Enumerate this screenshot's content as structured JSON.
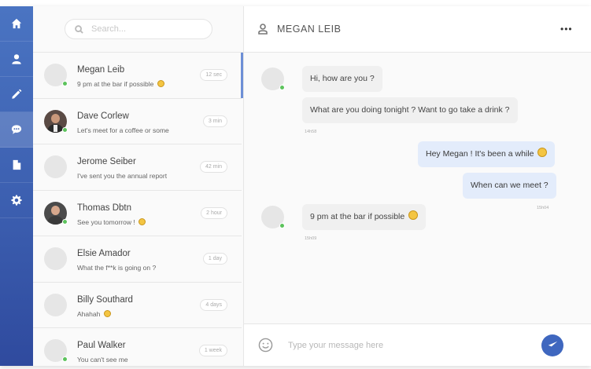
{
  "nav": {
    "items": [
      {
        "icon": "home-icon",
        "active": false
      },
      {
        "icon": "user-icon",
        "active": false
      },
      {
        "icon": "pencil-icon",
        "active": false
      },
      {
        "icon": "chat-icon",
        "active": true
      },
      {
        "icon": "document-icon",
        "active": false
      },
      {
        "icon": "gear-icon",
        "active": false
      }
    ]
  },
  "search": {
    "placeholder": "Search..."
  },
  "contacts": [
    {
      "name": "Megan Leib",
      "message": "9 pm at the bar if possible",
      "time": "12 sec",
      "online": true,
      "photo": false,
      "emoji": true
    },
    {
      "name": "Dave Corlew",
      "message": "Let's meet for a coffee or some",
      "time": "3 min",
      "online": true,
      "photo": true,
      "emoji": false
    },
    {
      "name": "Jerome Seiber",
      "message": "I've sent you the annual report",
      "time": "42 min",
      "online": false,
      "photo": false,
      "emoji": false
    },
    {
      "name": "Thomas Dbtn",
      "message": "See you tomorrow !",
      "time": "2 hour",
      "online": true,
      "photo": true,
      "emoji": true
    },
    {
      "name": "Elsie Amador",
      "message": "What the f**k is going on ?",
      "time": "1 day",
      "online": false,
      "photo": false,
      "emoji": false
    },
    {
      "name": "Billy Southard",
      "message": "Ahahah",
      "time": "4 days",
      "online": false,
      "photo": false,
      "emoji": true
    },
    {
      "name": "Paul Walker",
      "message": "You can't see me",
      "time": "1 week",
      "online": true,
      "photo": false,
      "emoji": false
    }
  ],
  "chat": {
    "title": "MEGAN LEIB",
    "more_label": "•••",
    "messages": [
      {
        "direction": "in",
        "text": "Hi, how are you ?"
      },
      {
        "direction": "in",
        "text": "What are you doing tonight ? Want to go take a drink ?"
      },
      {
        "direction": "out",
        "text": "Hey Megan ! It's been a while"
      },
      {
        "direction": "out",
        "text": "When can we meet ?"
      },
      {
        "direction": "in",
        "text": "9 pm at the bar if possible"
      }
    ],
    "stamps": [
      "14h58",
      "15h04",
      "15h09"
    ]
  },
  "composer": {
    "placeholder": "Type your message here"
  },
  "colors": {
    "nav_top": "#4a74c2",
    "nav_bottom": "#2f4a9e",
    "send_button": "#3f67bf",
    "outgoing_bubble": "#e3ecfb",
    "online": "#5cc35c"
  }
}
